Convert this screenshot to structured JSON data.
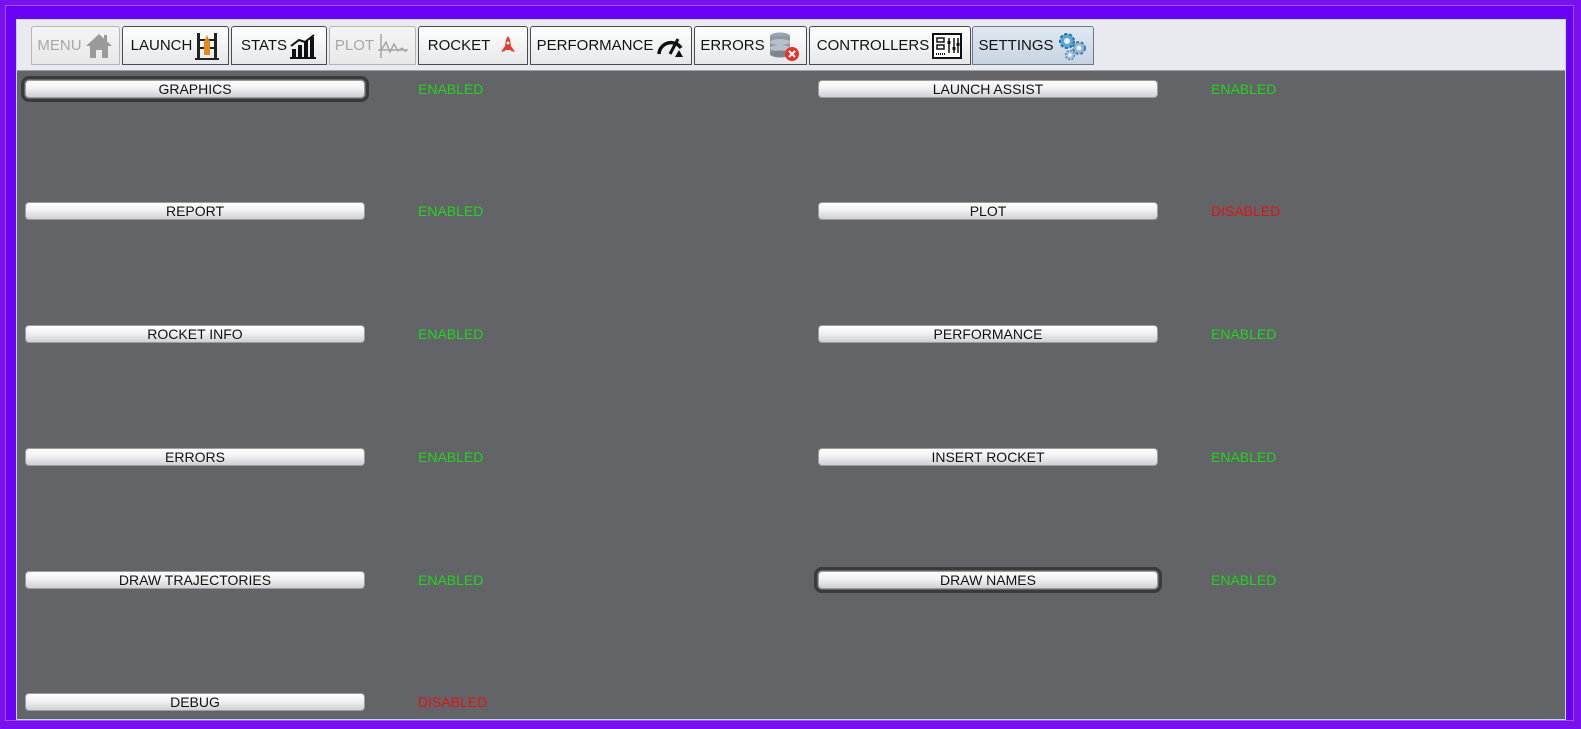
{
  "tabs": [
    {
      "label": "MENU",
      "icon": "home-icon",
      "state": "disabled"
    },
    {
      "label": "LAUNCH",
      "icon": "launch-pad-icon",
      "state": "normal"
    },
    {
      "label": "STATS",
      "icon": "bar-chart-icon",
      "state": "normal"
    },
    {
      "label": "PLOT",
      "icon": "line-plot-icon",
      "state": "disabled"
    },
    {
      "label": "ROCKET",
      "icon": "rocket-icon",
      "state": "normal"
    },
    {
      "label": "PERFORMANCE",
      "icon": "speedometer-icon",
      "state": "normal"
    },
    {
      "label": "ERRORS",
      "icon": "database-error-icon",
      "state": "normal"
    },
    {
      "label": "CONTROLLERS",
      "icon": "control-panel-icon",
      "state": "normal"
    },
    {
      "label": "SETTINGS",
      "icon": "gears-icon",
      "state": "active"
    }
  ],
  "settings": {
    "left": [
      {
        "label": "GRAPHICS",
        "status": "ENABLED"
      },
      {
        "label": "REPORT",
        "status": "ENABLED"
      },
      {
        "label": "ROCKET INFO",
        "status": "ENABLED"
      },
      {
        "label": "ERRORS",
        "status": "ENABLED"
      },
      {
        "label": "DRAW TRAJECTORIES",
        "status": "ENABLED"
      },
      {
        "label": "DEBUG",
        "status": "DISABLED"
      }
    ],
    "right": [
      {
        "label": "LAUNCH ASSIST",
        "status": "ENABLED"
      },
      {
        "label": "PLOT",
        "status": "DISABLED"
      },
      {
        "label": "PERFORMANCE",
        "status": "ENABLED"
      },
      {
        "label": "INSERT ROCKET",
        "status": "ENABLED"
      },
      {
        "label": "DRAW NAMES",
        "status": "ENABLED"
      }
    ]
  },
  "colors": {
    "enabled": "#22d41e",
    "disabled": "#e01313",
    "background": "#636467",
    "border": "#6a00f4"
  }
}
